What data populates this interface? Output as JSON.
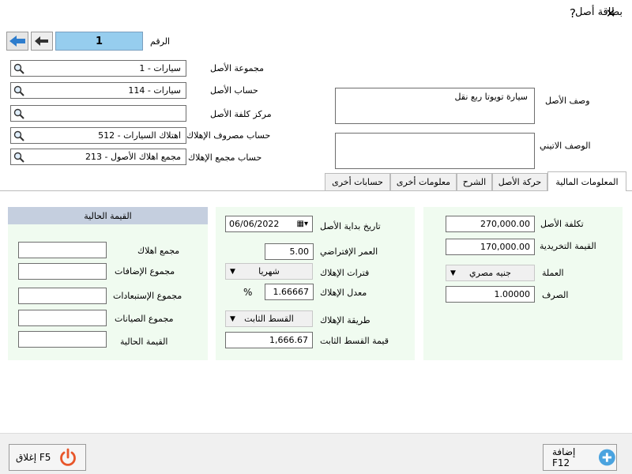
{
  "window": {
    "title": "بطاقة أصل",
    "help": "?",
    "close": "✕"
  },
  "header": {
    "number_label": "الرقم",
    "number_value": "1"
  },
  "fields": {
    "asset_group": {
      "label": "مجموعة الأصل",
      "value": "1 - سيارات"
    },
    "asset_account": {
      "label": "حساب الأصل",
      "value": "114 - سيارات"
    },
    "cost_center": {
      "label": "مركز كلفة الأصل",
      "value": ""
    },
    "dep_expense_account": {
      "label": "حساب مصروف الإهلاك",
      "value": "512 - اهتلاك السيارات"
    },
    "acc_dep_account": {
      "label": "حساب مجمع الإهلاك",
      "value": "213 - مجمع اهلاك الأصول"
    }
  },
  "description": {
    "label": "وصف الأصل",
    "value": "سيارة تويوتا ربع نقل"
  },
  "latin_description": {
    "label": "الوصف الاتيني",
    "value": ""
  },
  "tabs": [
    {
      "label": "المعلومات المالية",
      "active": true
    },
    {
      "label": "حركة الأصل",
      "active": false
    },
    {
      "label": "الشرح",
      "active": false
    },
    {
      "label": "معلومات أخرى",
      "active": false
    },
    {
      "label": "حسابات أخرى",
      "active": false
    }
  ],
  "financial": {
    "cost": {
      "label": "تكلفة الأصل",
      "value": "270,000.00"
    },
    "salvage": {
      "label": "القيمة التخريدية",
      "value": "170,000.00"
    },
    "currency": {
      "label": "العملة",
      "value": "جنيه مصري"
    },
    "rate": {
      "label": "الصرف",
      "value": "1.00000"
    }
  },
  "depreciation": {
    "start_date": {
      "label": "تاريخ بداية الأصل",
      "value": "06/06/2022"
    },
    "life": {
      "label": "العمر الإفتراضي",
      "value": "5.00"
    },
    "periods": {
      "label": "فترات الإهلاك",
      "value": "شهريا"
    },
    "rate": {
      "label": "معدل الإهلاك",
      "value": "1.66667",
      "unit": "%"
    },
    "method": {
      "label": "طريقة الإهلاك",
      "value": "القسط الثابت"
    },
    "installment": {
      "label": "قيمة القسط الثابت",
      "value": "1,666.67"
    }
  },
  "current_value": {
    "header": "القيمة الحالية",
    "rows": [
      {
        "label": "مجمع اهلاك",
        "value": ""
      },
      {
        "label": "مجموع الإضافات",
        "value": ""
      },
      {
        "label": "مجموع الإستبعادات",
        "value": ""
      },
      {
        "label": "مجموع الصيانات",
        "value": ""
      },
      {
        "label": "القيمة الحالية",
        "value": ""
      }
    ]
  },
  "buttons": {
    "add": "إضافة F12",
    "close": "إغلاق F5"
  },
  "colors": {
    "number_box": "#96cdee",
    "panel_bg": "#f0fbf0",
    "panel_header": "#c5cfdf",
    "add_icon": "#4aa3df",
    "close_icon": "#e8562a"
  }
}
